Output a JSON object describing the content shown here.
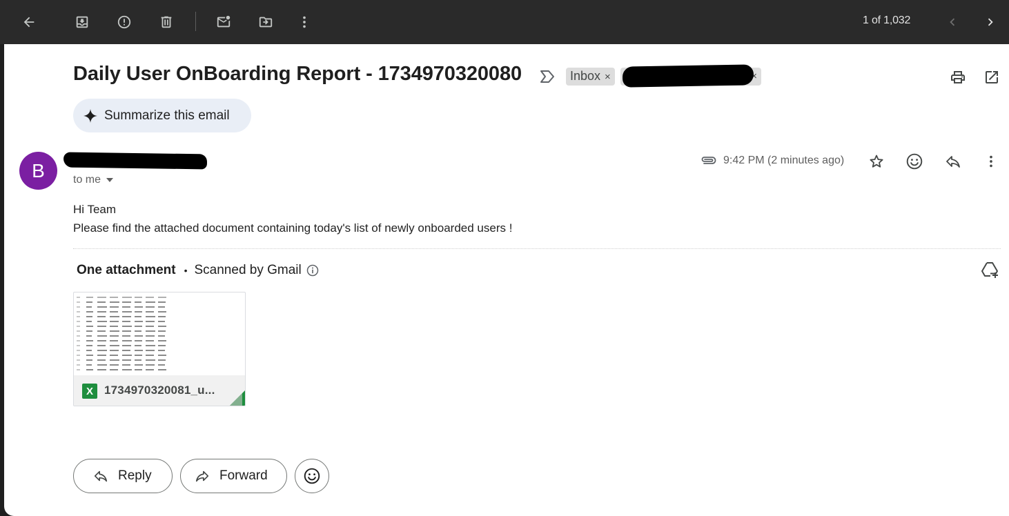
{
  "toolbar": {
    "pager_text": "1 of 1,032",
    "icons": [
      "back-arrow-icon",
      "archive-icon",
      "report-spam-icon",
      "delete-icon",
      "mark-unread-icon",
      "move-to-icon",
      "more-vert-icon",
      "chevron-left-icon",
      "chevron-right-icon"
    ]
  },
  "email": {
    "subject": "Daily User OnBoarding Report - 1734970320080",
    "labels": [
      {
        "text": "Inbox",
        "close": "×"
      }
    ],
    "summarize_label": "Summarize this email",
    "sender_initial": "B",
    "recipient_label": "to me",
    "timestamp": "9:42 PM (2 minutes ago)",
    "body_lines": [
      "Hi Team",
      "Please find the attached document containing today's list of newly onboarded users !"
    ]
  },
  "attachments": {
    "count_label": "One attachment",
    "scan_label": "Scanned by Gmail",
    "files": [
      {
        "name": "1734970320081_u...",
        "type_badge": "X"
      }
    ]
  },
  "actions": {
    "reply_label": "Reply",
    "forward_label": "Forward"
  },
  "colors": {
    "toolbar_bg": "#2a2a2a",
    "avatar_bg": "#7b1fa2",
    "summarize_bg": "#e9eef6",
    "excel_green": "#1e8e3e",
    "chip_bg": "#dddddd"
  }
}
